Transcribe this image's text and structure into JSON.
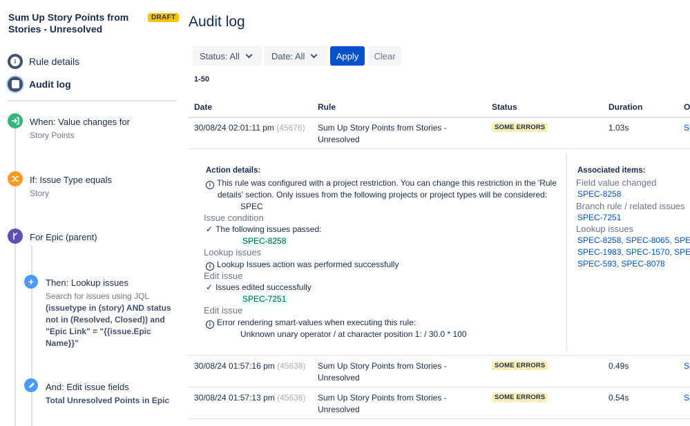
{
  "sidebar": {
    "rule_title": "Sum Up Story Points from Stories - Unresolved",
    "draft_badge": "DRAFT",
    "nav": [
      {
        "label": "Rule details",
        "icon": "info-icon"
      },
      {
        "label": "Audit log",
        "icon": "audit-log-icon"
      }
    ],
    "components": [
      {
        "title": "When: Value changes for",
        "subtitle": "Story Points",
        "icon": "trigger-icon",
        "color": "#36b37e"
      },
      {
        "title": "If: Issue Type equals",
        "subtitle": "Story",
        "icon": "condition-shuffle-icon",
        "color": "#ff991f"
      },
      {
        "title": "For Epic (parent)",
        "icon": "branch-icon",
        "color": "#5e4db2"
      },
      {
        "title": "Then: Lookup issues",
        "subtitle_prefix": "Search for issues using JQL",
        "subtitle_bold": "(issuetype in (story) AND status not in (Resolved, Closed)) and \"Epic Link\" = \"{{issue.Epic Name}}\"",
        "icon": "plus-icon",
        "color": "#4c9aff"
      },
      {
        "title": "And: Edit issue fields",
        "subtitle_bold": "Total Unresolved Points in Epic",
        "icon": "pencil-icon",
        "color": "#4c9aff"
      }
    ]
  },
  "main": {
    "title": "Audit log",
    "filters": {
      "status": "Status: All",
      "date": "Date: All",
      "apply": "Apply",
      "clear": "Clear"
    },
    "range": "1-50",
    "columns": [
      "Date",
      "Rule",
      "Status",
      "Duration",
      "O"
    ],
    "rows": [
      {
        "date": "30/08/24 02:01:11 pm",
        "exec": "(45676)",
        "rule_line1": "Sum Up Story Points from Stories -",
        "rule_line2": "Unresolved",
        "status": "SOME ERRORS",
        "duration": "1.03s",
        "out": "Sl"
      },
      {
        "date": "30/08/24 01:57:16 pm",
        "exec": "(45638)",
        "rule_line1": "Sum Up Story Points from Stories -",
        "rule_line2": "Unresolved",
        "status": "SOME ERRORS",
        "duration": "0.49s",
        "out": "Sl"
      },
      {
        "date": "30/08/24 01:57:13 pm",
        "exec": "(45636)",
        "rule_line1": "Sum Up Story Points from Stories -",
        "rule_line2": "Unresolved",
        "status": "SOME ERRORS",
        "duration": "0.54s",
        "out": "Sl"
      }
    ],
    "details": {
      "heading": "Action details:",
      "restriction_lines": [
        "This rule was configured with a project restriction. You can change this restriction in the 'Rule",
        "details' section. Only issues from the following projects or project types will be considered:",
        "SPEC"
      ],
      "section1": "Issue condition",
      "passed": "The following issues passed:",
      "passed_issue": "SPEC-8258",
      "section2": "Lookup issues",
      "lookup_msg": "Lookup Issues action was performed successfully",
      "section3": "Edit issue",
      "edited_msg": "Issues edited successfully",
      "edited_issue": "SPEC-7251",
      "section4": "Edit issue",
      "error_msg": "Error rendering smart-values when executing this rule:",
      "error_detail": "Unknown unary operator / at character position 1: / 30.0 * 100"
    },
    "associated": {
      "heading": "Associated items:",
      "field_label": "Field value changed",
      "field_item": "SPEC-8258",
      "branch_label": "Branch rule / related issues",
      "branch_item": "SPEC-7251",
      "lookup_label": "Lookup issues",
      "lookup_line1": "SPEC-8258, SPEC-8065, SPE",
      "lookup_line2": "SPEC-1983, SPEC-1570, SPE",
      "lookup_line3": "SPEC-593, SPEC-8078"
    }
  }
}
